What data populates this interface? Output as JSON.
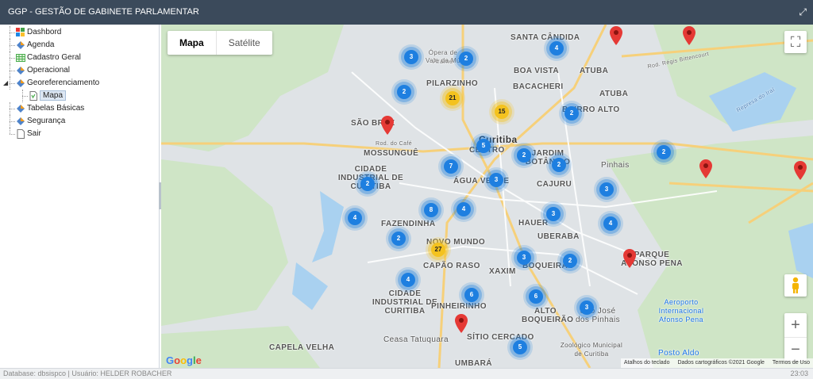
{
  "app": {
    "title": "GGP - GESTÃO DE GABINETE PARLAMENTAR"
  },
  "sidebar": {
    "items": [
      {
        "label": "Dashbord",
        "icon": "dashboard-icon"
      },
      {
        "label": "Agenda",
        "icon": "module-icon"
      },
      {
        "label": "Cadastro Geral",
        "icon": "table-icon"
      },
      {
        "label": "Operacional",
        "icon": "module-icon"
      },
      {
        "label": "Georeferenciamento",
        "icon": "module-icon",
        "expanded": true,
        "children": [
          {
            "label": "Mapa",
            "icon": "page-icon",
            "selected": true
          }
        ]
      },
      {
        "label": "Tabelas Básicas",
        "icon": "module-icon"
      },
      {
        "label": "Segurança",
        "icon": "module-icon"
      },
      {
        "label": "Sair",
        "icon": "page-icon"
      }
    ]
  },
  "map": {
    "maptype": {
      "map": "Mapa",
      "satellite": "Satélite",
      "selected": "Mapa"
    },
    "clusters": [
      "3",
      "2",
      "4",
      "2",
      "21",
      "15",
      "2",
      "5",
      "2",
      "7",
      "2",
      "3",
      "2",
      "3",
      "2",
      "4",
      "8",
      "4",
      "3",
      "4",
      "2",
      "27",
      "3",
      "2",
      "4",
      "6",
      "6",
      "3",
      "5"
    ],
    "labels": {
      "santa_candida": "SANTA CÂNDIDA",
      "boa_vista": "BOA VISTA",
      "atuba": "ATUBA",
      "bacacheri": "BACACHERI",
      "pilarzinho": "PILARZINHO",
      "bairro_alto": "BAIRRO ALTO",
      "sao_braz": "SÃO BRAZ",
      "mossungue": "MOSSUNGUÊ",
      "curitiba": "Curitiba",
      "centro": "CENTRO",
      "jardim_botanico": "JARDIM BOTÂNICO",
      "cidade_industrial": "CIDADE INDUSTRIAL DE CURITIBA",
      "agua_verde": "ÁGUA VERDE",
      "cajuru": "CAJURU",
      "pinhais": "Pinhais",
      "fazendinha": "FAZENDINHA",
      "hauer": "HAUER",
      "uberaba": "UBERABA",
      "novo_mundo": "NOVO MUNDO",
      "capao_raso": "CAPÃO RASO",
      "xaxim": "XAXIM",
      "boqueirao": "BOQUEIRÃO",
      "parque_afonso_pena": "PARQUE AFONSO PENA",
      "pinheirinho": "PINHEIRINHO",
      "alto_boqueirao": "ALTO BOQUEIRÃO",
      "sao_jose": "São José dos Pinhais",
      "aeroporto": "Aeroporto Internacional Afonso Pena",
      "capela_velha": "CAPELA VELHA",
      "sitio_cercado": "SÍTIO CERCADO",
      "ceasa": "Ceasa Tatuquara",
      "umbara": "UMBARÁ",
      "zoologico": "Zoológico Municipal de Curitiba",
      "posto": "Posto Aldo",
      "opera_arame": "Ópera de Arame",
      "vale_da_musica": "Vale da Música",
      "rod_cafe": "Rod. do Café",
      "rod_regis": "Rod. Régis Bittencourt",
      "represa": "Represa do Iraí"
    },
    "attribution": {
      "keyboard": "Atalhos do teclado",
      "data": "Dados cartográficos ©2021 Google",
      "terms": "Termos de Uso"
    },
    "google_logo": "Google",
    "colors": {
      "cluster_blue": "#1e7fe0",
      "cluster_yellow": "#f4c21e",
      "pin_red": "#e53935"
    }
  },
  "status": {
    "info": "Database: dbsispco | Usuário: HELDER ROBACHER",
    "time": "23:03"
  }
}
